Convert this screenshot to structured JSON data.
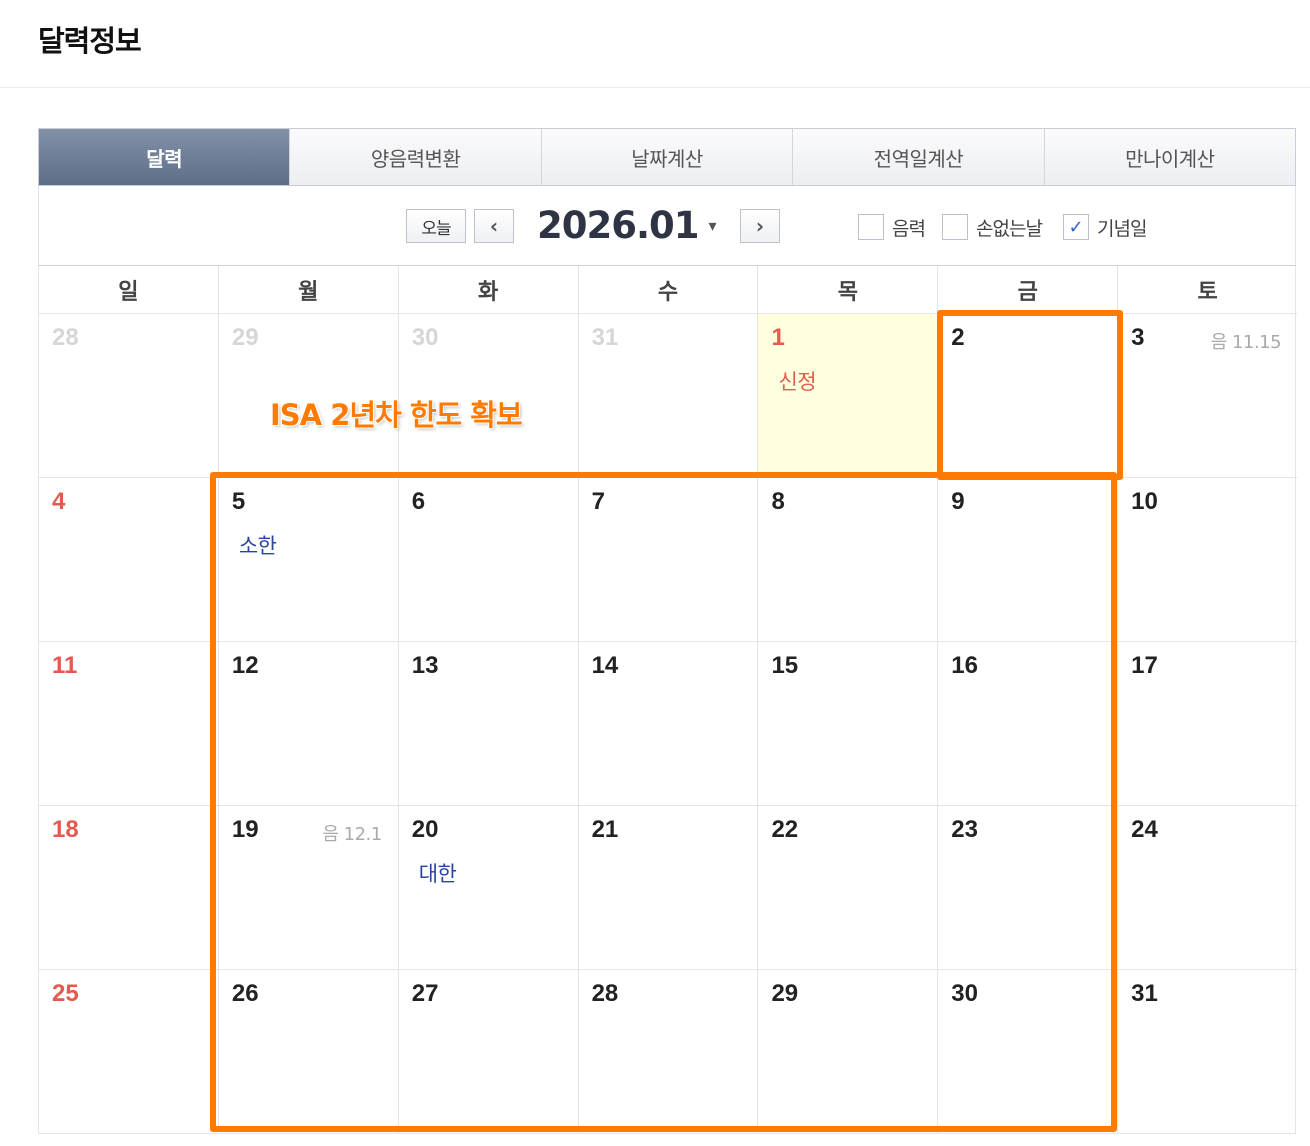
{
  "page": {
    "title": "달력정보"
  },
  "tabs": [
    {
      "label": "달력",
      "active": true
    },
    {
      "label": "양음력변환",
      "active": false
    },
    {
      "label": "날짜계산",
      "active": false
    },
    {
      "label": "전역일계산",
      "active": false
    },
    {
      "label": "만나이계산",
      "active": false
    }
  ],
  "toolbar": {
    "today_label": "오늘",
    "prev_icon": "‹",
    "next_icon": "›",
    "month": "2026.01",
    "caret_icon": "▾",
    "filters": [
      {
        "label": "음력",
        "checked": false
      },
      {
        "label": "손없는날",
        "checked": false
      },
      {
        "label": "기념일",
        "checked": true
      }
    ],
    "check_mark": "✓"
  },
  "weekdays": [
    "일",
    "월",
    "화",
    "수",
    "목",
    "금",
    "토"
  ],
  "weeks": [
    [
      {
        "num": "28",
        "other": true
      },
      {
        "num": "29",
        "other": true
      },
      {
        "num": "30",
        "other": true
      },
      {
        "num": "31",
        "other": true
      },
      {
        "num": "1",
        "holiday": true,
        "today": true,
        "event": "신정",
        "event_type": "holiday"
      },
      {
        "num": "2"
      },
      {
        "num": "3",
        "lunar": "음 11.15"
      }
    ],
    [
      {
        "num": "4",
        "sun": true
      },
      {
        "num": "5",
        "event": "소한",
        "event_type": "term"
      },
      {
        "num": "6"
      },
      {
        "num": "7"
      },
      {
        "num": "8"
      },
      {
        "num": "9"
      },
      {
        "num": "10"
      }
    ],
    [
      {
        "num": "11",
        "sun": true
      },
      {
        "num": "12"
      },
      {
        "num": "13"
      },
      {
        "num": "14"
      },
      {
        "num": "15"
      },
      {
        "num": "16"
      },
      {
        "num": "17"
      }
    ],
    [
      {
        "num": "18",
        "sun": true
      },
      {
        "num": "19",
        "lunar": "음 12.1"
      },
      {
        "num": "20",
        "event": "대한",
        "event_type": "term"
      },
      {
        "num": "21"
      },
      {
        "num": "22"
      },
      {
        "num": "23"
      },
      {
        "num": "24"
      }
    ],
    [
      {
        "num": "25",
        "sun": true
      },
      {
        "num": "26"
      },
      {
        "num": "27"
      },
      {
        "num": "28"
      },
      {
        "num": "29"
      },
      {
        "num": "30"
      },
      {
        "num": "31"
      }
    ]
  ],
  "annotation": {
    "text": "ISA 2년차 한도 확보",
    "color": "#ff7a00"
  }
}
